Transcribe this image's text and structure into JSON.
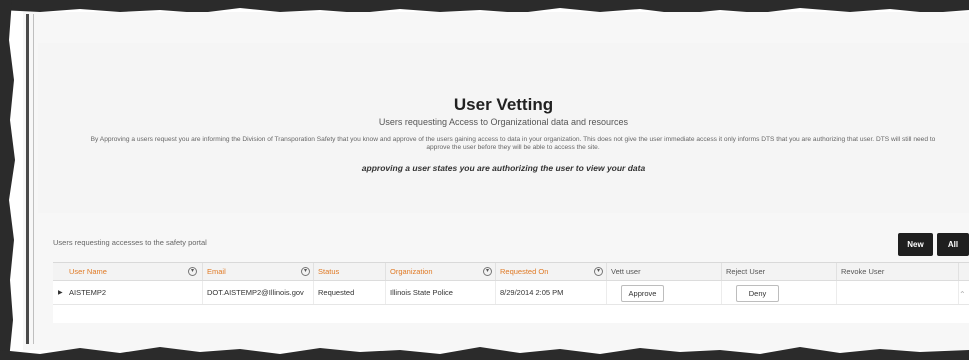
{
  "header": {
    "title": "User Vetting",
    "subtitle": "Users requesting Access to Organizational data and resources",
    "description": "By Approving a users request you are informing the Division of Transporation Safety that you know and approve of the users gaining access to data in your organization. This does not give the user immediate access it only informs DTS that you are authorizing that user. DTS will still need to approve the user before they will be able to access the site.",
    "emphasis": "approving a user states you are authorizing the user to view your data"
  },
  "grid_caption": "Users requesting accesses to the safety portal",
  "toolbar": {
    "new_label": "New",
    "all_label": "All"
  },
  "columns": [
    {
      "label": "User Name",
      "filter": true
    },
    {
      "label": "Email",
      "filter": true
    },
    {
      "label": "Status",
      "filter": false
    },
    {
      "label": "Organization",
      "filter": true
    },
    {
      "label": "Requested On",
      "filter": true
    },
    {
      "label": "Vett user",
      "filter": false
    },
    {
      "label": "Reject User",
      "filter": false
    },
    {
      "label": "Revoke User",
      "filter": false
    }
  ],
  "rows": [
    {
      "user_name": "AISTEMP2",
      "email": "DOT.AISTEMP2@Illinois.gov",
      "status": "Requested",
      "organization": "Illinois State Police",
      "requested_on": "8/29/2014 2:05 PM",
      "approve_label": "Approve",
      "deny_label": "Deny"
    }
  ],
  "icons": {
    "filter": "filter-icon",
    "expand": "expand-arrow-icon",
    "scroll": "scroll-up-icon"
  },
  "colors": {
    "header_accent": "#e07a25",
    "button_dark": "#1f1f1f"
  }
}
